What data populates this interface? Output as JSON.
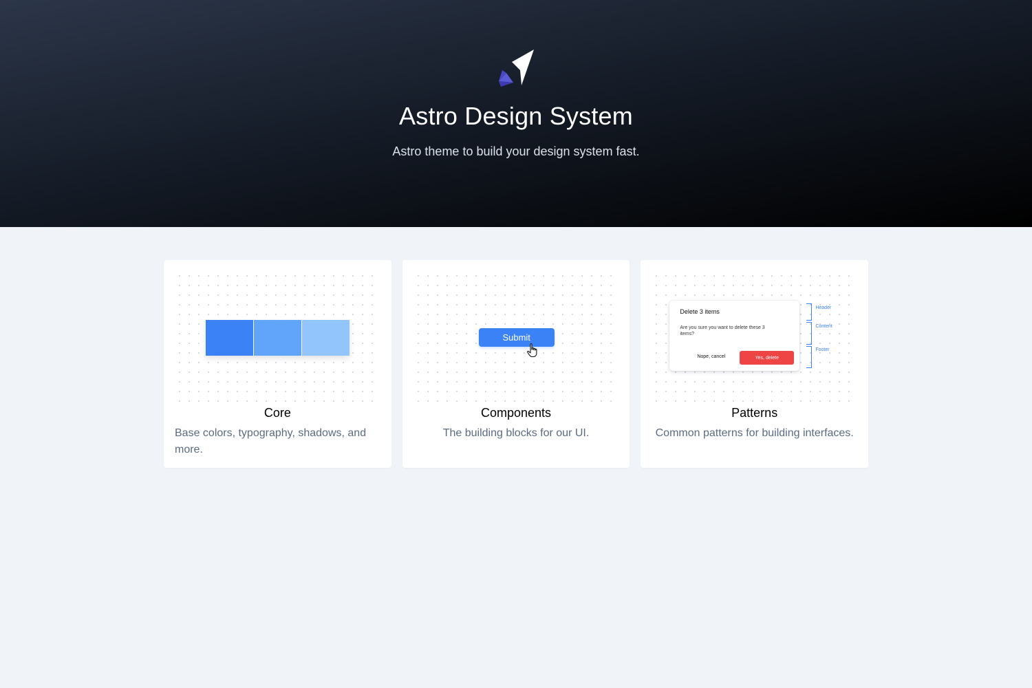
{
  "hero": {
    "logo_icon": "astro-rocket-logo",
    "title": "Astro Design System",
    "subtitle": "Astro theme to build your design system fast."
  },
  "cards": [
    {
      "title": "Core",
      "description": "Base colors, typography, shadows, and more.",
      "preview": {
        "swatch_colors": [
          "#3b82f6",
          "#60a5fa",
          "#93c5fd"
        ]
      }
    },
    {
      "title": "Components",
      "description": "The building blocks for our UI.",
      "preview": {
        "button_label": "Submit",
        "cursor_icon": "pointer-hand-icon"
      }
    },
    {
      "title": "Patterns",
      "description": "Common patterns for building interfaces.",
      "preview": {
        "modal_title": "Delete 3 items",
        "modal_body": "Are you sure you want to delete these 3 items?",
        "cancel_label": "Nope, cancel",
        "confirm_label": "Yes, delete",
        "annotations": {
          "header": "Header",
          "content": "Content",
          "footer": "Footer"
        }
      }
    }
  ],
  "colors": {
    "accent": "#3b82f6",
    "danger": "#ef4444",
    "logo_accent": "#6366f1"
  }
}
